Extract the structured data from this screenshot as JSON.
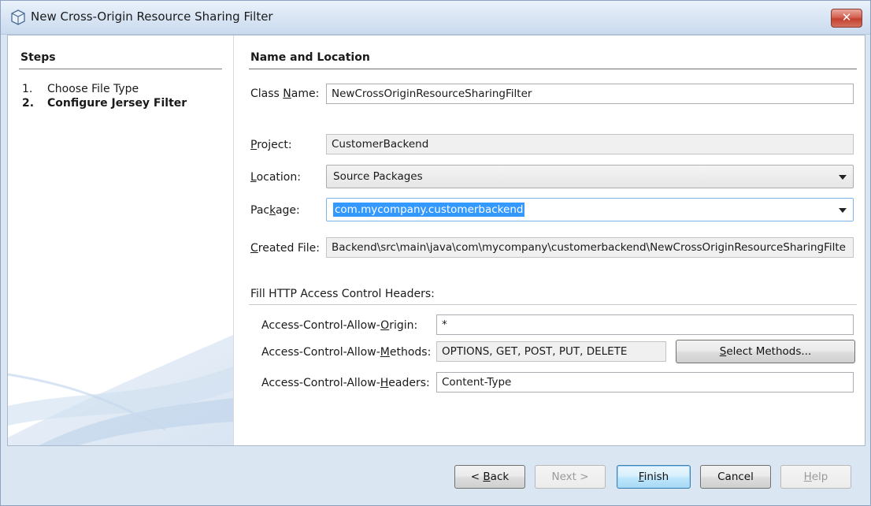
{
  "window": {
    "title": "New Cross-Origin Resource Sharing Filter",
    "close_glyph": "✕"
  },
  "steps": {
    "title": "Steps",
    "items": [
      {
        "num": "1.",
        "label": "Choose File Type"
      },
      {
        "num": "2.",
        "label": "Configure Jersey Filter"
      }
    ]
  },
  "main": {
    "section_title": "Name and Location",
    "class_name": {
      "label_pre": "Class ",
      "label_key": "N",
      "label_post": "ame:",
      "value": "NewCrossOriginResourceSharingFilter"
    },
    "project": {
      "label_pre": "",
      "label_key": "P",
      "label_post": "roject:",
      "value": "CustomerBackend"
    },
    "location": {
      "label_pre": "",
      "label_key": "L",
      "label_post": "ocation:",
      "value": "Source Packages"
    },
    "package": {
      "label_pre": "Pac",
      "label_key": "k",
      "label_post": "age:",
      "value": "com.mycompany.customerbackend"
    },
    "created_file": {
      "label_pre": "",
      "label_key": "C",
      "label_post": "reated File:",
      "value": "Backend\\src\\main\\java\\com\\mycompany\\customerbackend\\NewCrossOriginResourceSharingFilte"
    },
    "headers_title": "Fill HTTP Access Control Headers:",
    "allow_origin": {
      "label_pre": "Access-Control-Allow-",
      "label_key": "O",
      "label_post": "rigin:",
      "value": "*"
    },
    "allow_methods": {
      "label_pre": "Access-Control-Allow-",
      "label_key": "M",
      "label_post": "ethods:",
      "value": "OPTIONS, GET, POST, PUT, DELETE"
    },
    "select_methods": {
      "label_pre": "",
      "label_key": "S",
      "label_post": "elect Methods..."
    },
    "allow_headers": {
      "label_pre": "Access-Control-Allow-",
      "label_key": "H",
      "label_post": "eaders:",
      "value": "Content-Type"
    }
  },
  "footer": {
    "back": {
      "pre": "< ",
      "key": "B",
      "post": "ack"
    },
    "next": "Next >",
    "finish": {
      "pre": "",
      "key": "F",
      "post": "inish"
    },
    "cancel": "Cancel",
    "help": {
      "pre": "",
      "key": "H",
      "post": "elp"
    }
  }
}
